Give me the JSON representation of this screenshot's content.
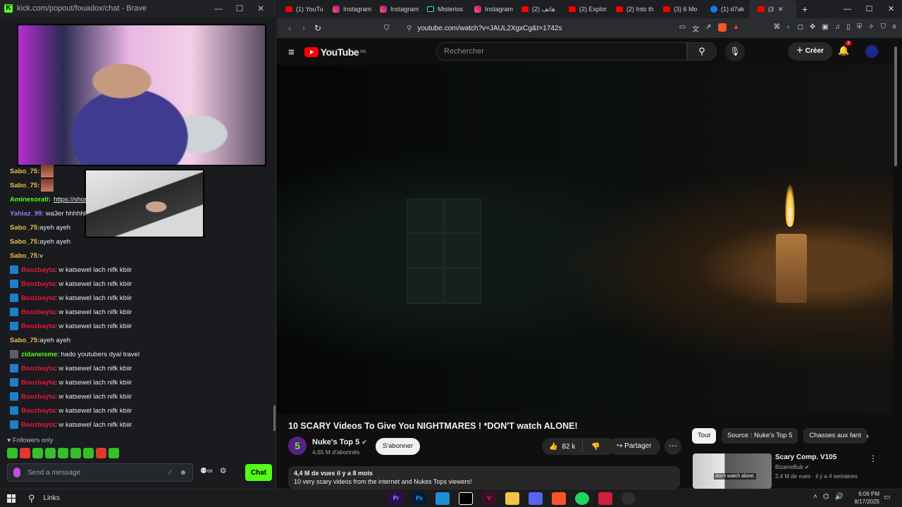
{
  "kick": {
    "title_url": "kick.com/popout/fouadox/chat - Brave",
    "messages": [
      {
        "user": "Sabo_75:",
        "text": "",
        "color": "yellow",
        "emote": true,
        "badge": ""
      },
      {
        "user": "Sabo_75:",
        "text": "",
        "color": "yellow",
        "emote": true,
        "badge": ""
      },
      {
        "user": "Aminesorati:",
        "text": "https://shor",
        "color": "green",
        "link": true,
        "badge": ""
      },
      {
        "user": "Yahiaz_99",
        "text": ": wa3er hhhhhl",
        "color": "purple",
        "badge": ""
      },
      {
        "user": "Sabo_75:",
        "text": " ayeh ayeh",
        "color": "yellow",
        "badge": ""
      },
      {
        "user": "Sabo_75:",
        "text": " ayeh ayeh",
        "color": "yellow",
        "badge": ""
      },
      {
        "user": "Sabo_75:",
        "text": " v",
        "color": "yellow",
        "badge": ""
      },
      {
        "user": "Boozbayta",
        "text": ": w katsewel lach nifk kbiir",
        "color": "red",
        "badge": "blue"
      },
      {
        "user": "Boozbayta",
        "text": ": w katsewel lach nifk kbiir",
        "color": "red",
        "badge": "blue"
      },
      {
        "user": "Boozbayta",
        "text": ": w katsewel lach nifk kbiir",
        "color": "red",
        "badge": "blue"
      },
      {
        "user": "Boozbayta",
        "text": ": w katsewel lach nifk kbiir",
        "color": "red",
        "badge": "blue"
      },
      {
        "user": "Boozbayta",
        "text": ": w katsewel lach nifk kbiir",
        "color": "red",
        "badge": "blue"
      },
      {
        "user": "Sabo_75:",
        "text": " ayeh ayeh",
        "color": "yellow",
        "badge": ""
      },
      {
        "user": "zidaneisme",
        "text": ": hado youtubers dyal travel",
        "color": "green",
        "badge": "grey"
      },
      {
        "user": "Boozbayta",
        "text": ": w katsewel lach nifk kbiir",
        "color": "red",
        "badge": "blue"
      },
      {
        "user": "Boozbayta",
        "text": ": w katsewel lach nifk kbiir",
        "color": "red",
        "badge": "blue"
      },
      {
        "user": "Boozbayta",
        "text": ": w katsewel lach nifk kbiir",
        "color": "red",
        "badge": "blue"
      },
      {
        "user": "Boozbayta",
        "text": ": w katsewel lach nifk kbiir",
        "color": "red",
        "badge": "blue"
      },
      {
        "user": "Boozbayta",
        "text": ": w katsewel lach nifk kbiir",
        "color": "red",
        "badge": "blue"
      }
    ],
    "followers_only": "Followers only",
    "input_placeholder": "Send a message",
    "chat_button": "Chat",
    "accent": "#53fc18"
  },
  "browser": {
    "tabs": [
      {
        "label": "(1) YouTu",
        "icon": "youtube-icon"
      },
      {
        "label": "Instagram",
        "icon": "instagram-icon"
      },
      {
        "label": "Instagram",
        "icon": "instagram-icon"
      },
      {
        "label": "Misterios",
        "icon": "tiktok-icon"
      },
      {
        "label": "Instagram",
        "icon": "instagram-icon"
      },
      {
        "label": "(2) هاتف",
        "icon": "youtube-icon"
      },
      {
        "label": "(2) Explor",
        "icon": "youtube-icon"
      },
      {
        "label": "(2) Into th",
        "icon": "youtube-icon"
      },
      {
        "label": "(3) 6 Mo",
        "icon": "youtube-icon"
      },
      {
        "label": "(1) d7ak",
        "icon": "facebook-icon"
      },
      {
        "label": "(3",
        "icon": "youtube-icon",
        "active": true
      }
    ],
    "url": "youtube.com/watch?v=JAUL2XgxCg&t=1742s"
  },
  "youtube": {
    "logo_text": "YouTube",
    "region": "MA",
    "search_placeholder": "Rechercher",
    "create_label": "Créer",
    "notifications": "3",
    "video_title": "10 SCARY Videos To Give You NIGHTMARES ! *DON'T watch ALONE!",
    "channel_name": "Nuke's Top 5",
    "subscribers": "4,65 M d'abonnés",
    "subscribe_label": "S'abonner",
    "likes": "82 k",
    "share_label": "Partager",
    "views_date": "4,4 M de vues  il y a 8 mois",
    "description": "10 very scary videos from the internet and Nukes Tops viewers!",
    "chips": [
      "Tout",
      "Source : Nuke's Top 5",
      "Chasses aux fant"
    ],
    "recommended": {
      "title": "Scary Comp. V105",
      "channel": "BizarreBub",
      "meta": "2,4 M de vues · il y a 4 semaines",
      "thumb_text": "don't watch alone."
    },
    "accent": "#ff0000"
  },
  "taskbar": {
    "links_label": "Links",
    "time": "6:06 PM",
    "date": "8/17/2025"
  }
}
